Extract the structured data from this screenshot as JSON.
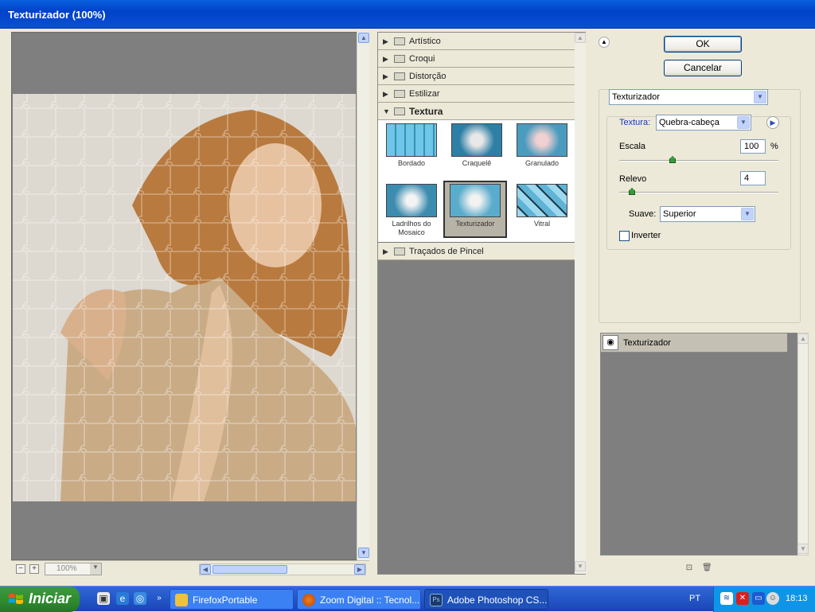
{
  "window": {
    "title": "Texturizador (100%)"
  },
  "preview": {
    "zoom": "100%"
  },
  "tree": {
    "categories_top": [
      "Artístico",
      "Croqui",
      "Distorção",
      "Estilizar"
    ],
    "open_category": "Textura",
    "thumbnails": [
      {
        "label": "Bordado"
      },
      {
        "label": "Craquelê"
      },
      {
        "label": "Granulado"
      },
      {
        "label": "Ladrilhos do Mosaico"
      },
      {
        "label": "Texturizador",
        "selected": true
      },
      {
        "label": "Vitral"
      }
    ],
    "categories_bottom": [
      "Traçados de Pincel"
    ]
  },
  "buttons": {
    "ok": "OK",
    "cancel": "Cancelar"
  },
  "filter_select": "Texturizador",
  "settings": {
    "texture_label": "Textura:",
    "texture_value": "Quebra-cabeça",
    "scale_label": "Escala",
    "scale_value": "100",
    "scale_unit": "%",
    "relief_label": "Relevo",
    "relief_value": "4",
    "light_label": "Suave:",
    "light_value": "Superior",
    "invert_label": "Inverter",
    "invert_checked": false
  },
  "layers": {
    "items": [
      "Texturizador"
    ]
  },
  "taskbar": {
    "start_label": "Iniciar",
    "tasks": [
      "FirefoxPortable",
      "Zoom Digital :: Tecnol...",
      "Adobe Photoshop CS..."
    ],
    "language": "PT",
    "clock": "18:13"
  },
  "colors": {
    "title_bar": "#0a5fe0",
    "taskbar": "#2456c8",
    "start": "#2f8a2f",
    "panel": "#ece9d8",
    "preview_bg": "#7f7f7f"
  }
}
